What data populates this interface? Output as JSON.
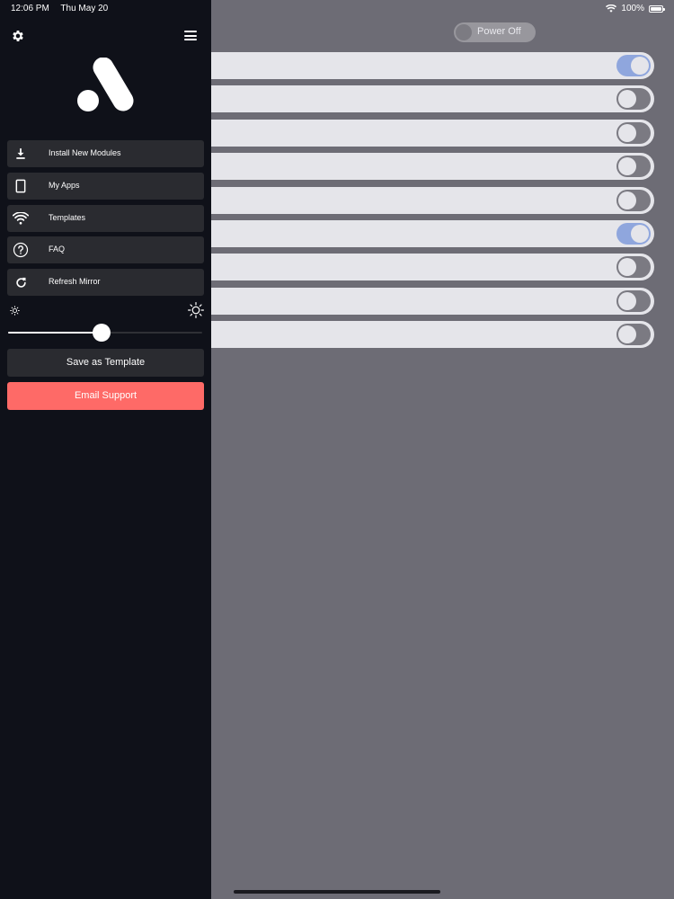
{
  "status_bar": {
    "time": "12:06 PM",
    "date": "Thu May 20",
    "battery": "100%"
  },
  "power_toggle": {
    "label": "Power Off",
    "on": false
  },
  "modules": [
    {
      "on": true
    },
    {
      "on": false
    },
    {
      "on": false
    },
    {
      "on": false
    },
    {
      "on": false
    },
    {
      "on": true
    },
    {
      "on": false
    },
    {
      "on": false
    },
    {
      "on": false
    }
  ],
  "drawer": {
    "menu": [
      {
        "label": "Install New Modules",
        "icon": "download-icon"
      },
      {
        "label": "My Apps",
        "icon": "tablet-icon"
      },
      {
        "label": "Templates",
        "icon": "wifi-icon"
      },
      {
        "label": "FAQ",
        "icon": "question-icon"
      },
      {
        "label": "Refresh Mirror",
        "icon": "refresh-icon"
      }
    ],
    "brightness": 0.48,
    "save_template_label": "Save as Template",
    "email_support_label": "Email Support"
  },
  "colors": {
    "drawer_bg": "#0f1119",
    "menu_item_bg": "#2a2b30",
    "email_button": "#fe6a67",
    "switch_on": "#8fa6dd",
    "switch_off": "#7b7a82",
    "row_bg": "#e5e5ea",
    "main_bg": "#6d6c75"
  }
}
